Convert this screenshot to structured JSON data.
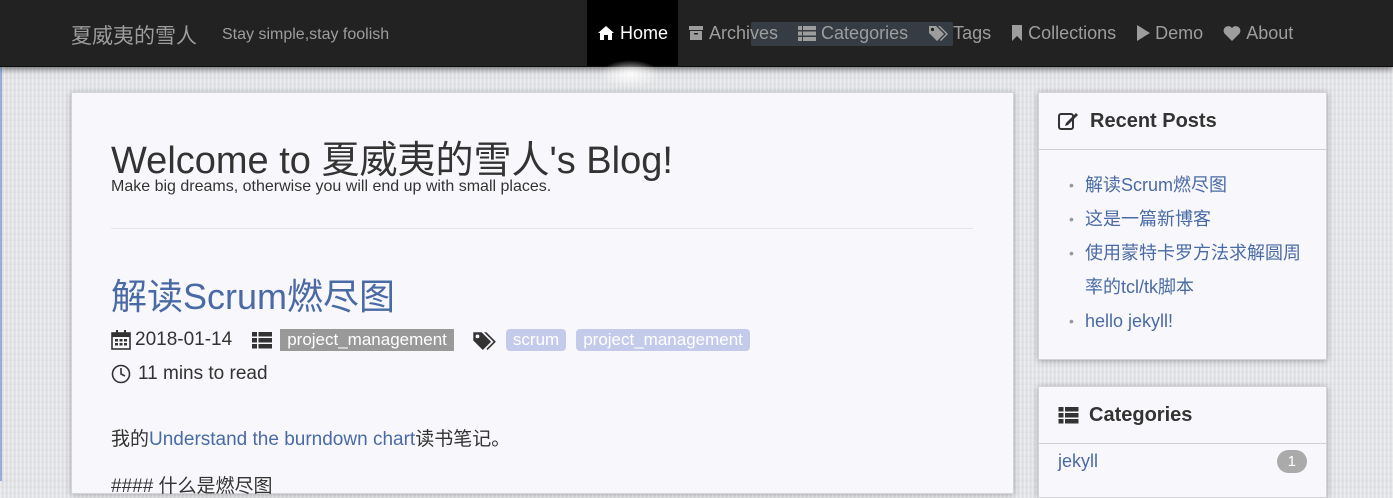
{
  "header": {
    "brand": "夏威夷的雪人",
    "tagline": "Stay simple,stay foolish",
    "nav": [
      {
        "label": "Home",
        "icon": "home-icon",
        "active": true
      },
      {
        "label": "Archives",
        "icon": "archive-icon",
        "active": false
      },
      {
        "label": "Categories",
        "icon": "list-icon",
        "active": false
      },
      {
        "label": "Tags",
        "icon": "tags-icon",
        "active": false
      },
      {
        "label": "Collections",
        "icon": "bookmark-icon",
        "active": false
      },
      {
        "label": "Demo",
        "icon": "play-icon",
        "active": false
      },
      {
        "label": "About",
        "icon": "heart-icon",
        "active": false
      }
    ]
  },
  "main": {
    "welcome": "Welcome to 夏威夷的雪人's Blog!",
    "motto": "Make big dreams, otherwise you will end up with small places.",
    "post": {
      "title": "解读Scrum燃尽图",
      "date": "2018-01-14",
      "category": "project_management",
      "tags": [
        "scrum",
        "project_management"
      ],
      "read_time": "11 mins to read",
      "excerpt_prefix": "我的",
      "excerpt_link": "Understand the burndown chart",
      "excerpt_suffix": "读书笔记。",
      "next_heading": "#### 什么是燃尽图"
    }
  },
  "sidebar": {
    "recent_title": "Recent Posts",
    "recent_posts": [
      "解读Scrum燃尽图",
      "这是一篇新博客",
      "使用蒙特卡罗方法求解圆周率的tcl/tk脚本",
      "hello jekyll!"
    ],
    "categories_title": "Categories",
    "categories": [
      {
        "name": "jekyll",
        "count": "1"
      }
    ]
  },
  "colors": {
    "link": "#4a6aa5",
    "navbar": "#222222",
    "tag": "#c4cbea",
    "category": "#999999"
  }
}
